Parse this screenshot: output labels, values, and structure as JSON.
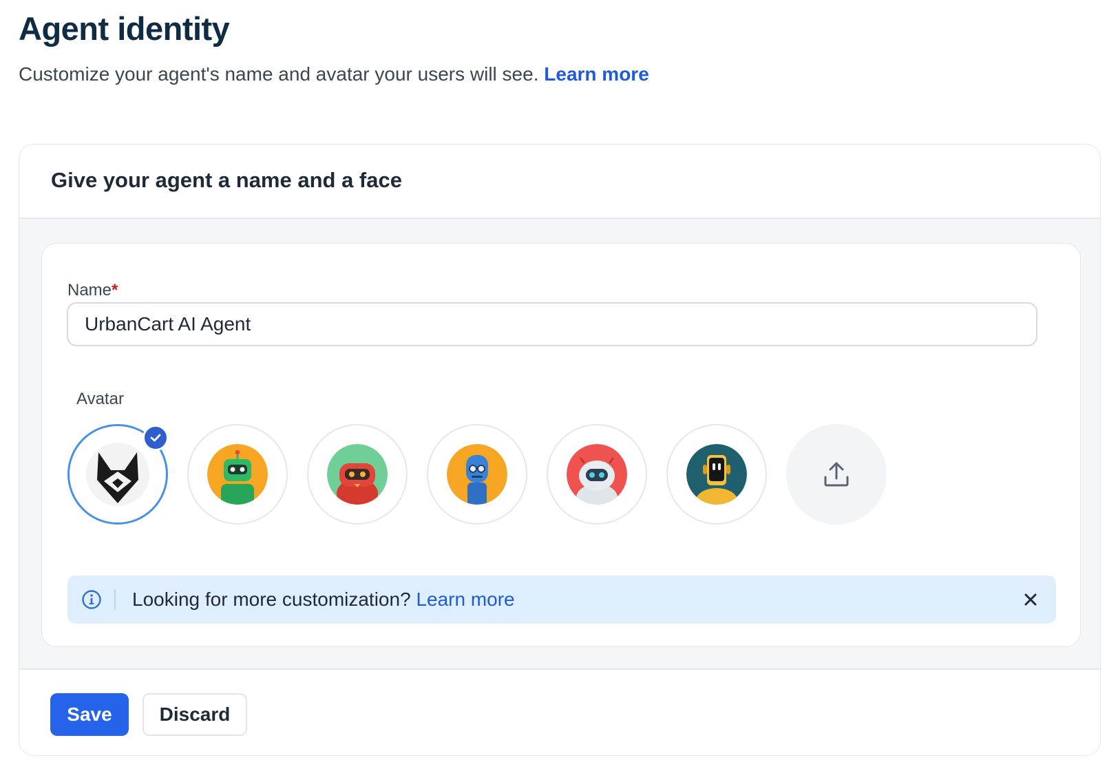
{
  "page": {
    "title": "Agent identity",
    "subtitle": "Customize your agent's name and avatar your users will see.",
    "learn_more": "Learn more"
  },
  "card": {
    "title": "Give your agent a name and a face"
  },
  "name_field": {
    "label": "Name",
    "required_marker": "*",
    "value": "UrbanCart AI Agent"
  },
  "avatar_section": {
    "label": "Avatar",
    "options": [
      {
        "icon": "fox-logo-icon",
        "selected": true
      },
      {
        "icon": "green-robot-icon",
        "bg": "#f6a623",
        "selected": false
      },
      {
        "icon": "red-robot-icon",
        "bg": "#6fcf97",
        "selected": false
      },
      {
        "icon": "blue-robot-icon",
        "bg": "#f6a623",
        "selected": false
      },
      {
        "icon": "white-robot-icon",
        "bg": "#ef5350",
        "selected": false
      },
      {
        "icon": "yellow-robot-icon",
        "bg": "#1f5f6e",
        "selected": false
      }
    ],
    "upload_icon": "upload-icon"
  },
  "banner": {
    "text": "Looking for more customization?",
    "link": "Learn more",
    "icon": "info-icon",
    "close_icon": "close-icon"
  },
  "footer": {
    "save_label": "Save",
    "discard_label": "Discard"
  },
  "colors": {
    "primary": "#2563eb",
    "link": "#1f5bd8",
    "heading": "#0f2c44",
    "banner_bg": "#dfeefc",
    "selected_ring": "#4a90e2",
    "required": "#c81e1e"
  }
}
